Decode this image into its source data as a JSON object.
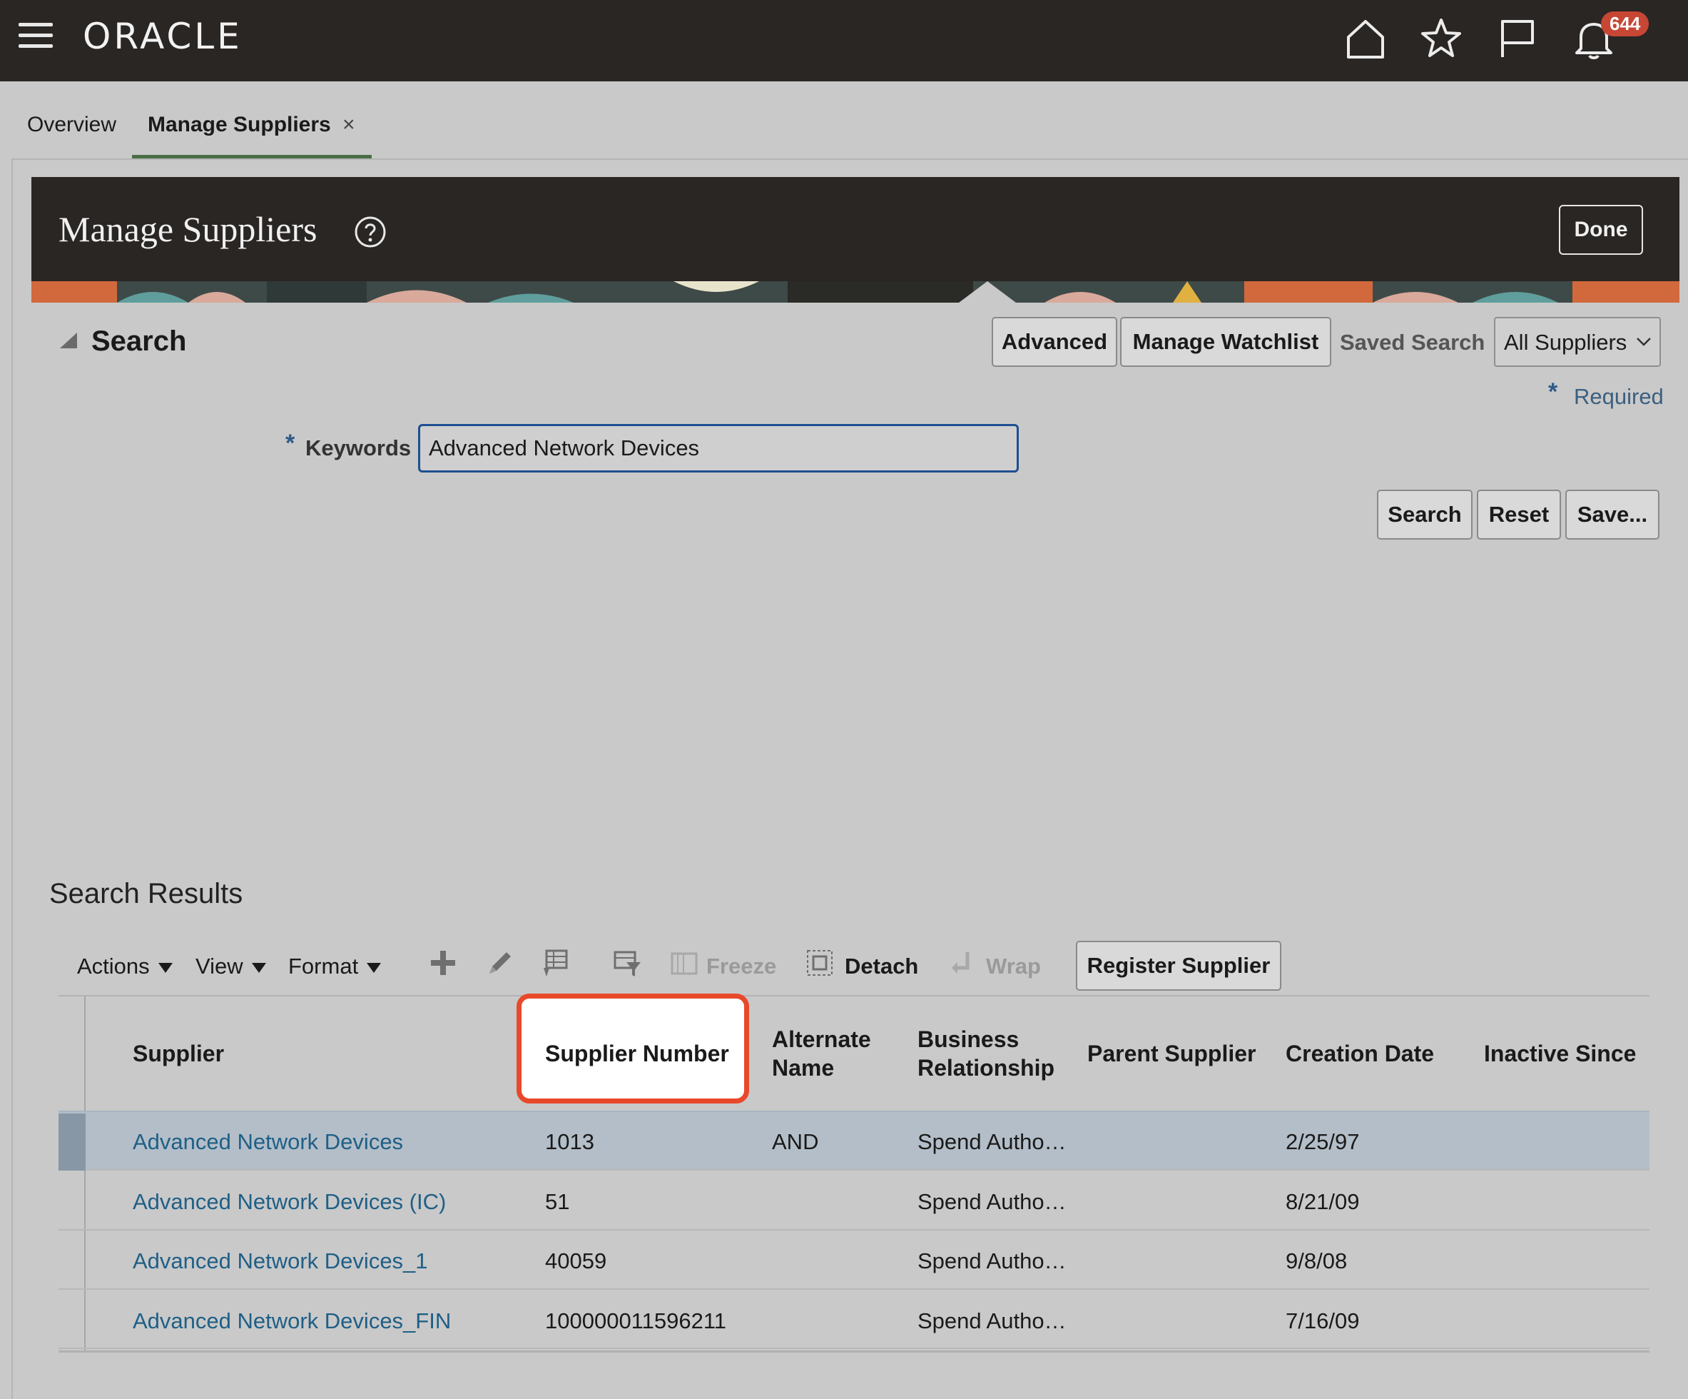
{
  "topbar": {
    "logo": "ORACLE",
    "notification_count": "644",
    "icons": [
      "hamburger-menu-icon",
      "home-icon",
      "star-icon",
      "flag-icon",
      "bell-icon"
    ]
  },
  "tabs": [
    {
      "label": "Overview",
      "active": false
    },
    {
      "label": "Manage Suppliers",
      "active": true,
      "close": "×"
    }
  ],
  "page": {
    "title": "Manage Suppliers",
    "done_label": "Done"
  },
  "search": {
    "section_title": "Search",
    "advanced_label": "Advanced",
    "watchlist_label": "Manage Watchlist",
    "saved_search_label": "Saved Search",
    "saved_search_value": "All Suppliers",
    "required_star": "*",
    "required_text": "Required",
    "keywords_label": "Keywords",
    "keywords_value": "Advanced Network Devices",
    "search_button": "Search",
    "reset_button": "Reset",
    "save_button": "Save..."
  },
  "results": {
    "title": "Search Results",
    "toolbar": {
      "actions": "Actions",
      "view": "View",
      "format": "Format",
      "freeze": "Freeze",
      "detach": "Detach",
      "wrap": "Wrap",
      "register": "Register Supplier"
    },
    "columns": {
      "supplier": "Supplier",
      "supplier_number": "Supplier Number",
      "alternate_name_1": "Alternate",
      "alternate_name_2": "Name",
      "business_rel_1": "Business",
      "business_rel_2": "Relationship",
      "parent_supplier": "Parent Supplier",
      "creation_date": "Creation Date",
      "inactive_since": "Inactive Since"
    },
    "rows": [
      {
        "supplier": "Advanced Network Devices",
        "number": "1013",
        "alternate": "AND",
        "relationship": "Spend Autho…",
        "parent": "",
        "created": "2/25/97",
        "inactive": ""
      },
      {
        "supplier": "Advanced Network Devices (IC)",
        "number": "51",
        "alternate": "",
        "relationship": "Spend Autho…",
        "parent": "",
        "created": "8/21/09",
        "inactive": ""
      },
      {
        "supplier": "Advanced Network Devices_1",
        "number": "40059",
        "alternate": "",
        "relationship": "Spend Autho…",
        "parent": "",
        "created": "9/8/08",
        "inactive": ""
      },
      {
        "supplier": "Advanced Network Devices_FIN",
        "number": "100000011596211",
        "alternate": "",
        "relationship": "Spend Autho…",
        "parent": "",
        "created": "7/16/09",
        "inactive": ""
      }
    ]
  },
  "colors": {
    "highlight": "#e8492a",
    "link": "#1f5f86",
    "topbar": "#2a2624",
    "badge": "#c74634"
  }
}
